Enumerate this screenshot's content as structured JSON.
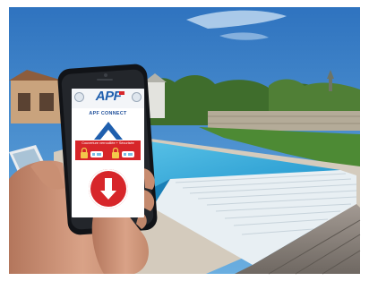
{
  "photo": {
    "subject": "hand-holding-smartphone-by-pool",
    "colors": {
      "sky": "#3d82c8",
      "pool_water": "#2ea7d8",
      "cover_slats": "#e8eff3",
      "deck": "#8d8580",
      "phone_body": "#111317",
      "skin": "#c99075",
      "lawn": "#4d8a34"
    }
  },
  "app": {
    "brand": "APF",
    "subtitle": "APF CONNECT",
    "status_text": "Couverture verrouillée + Sécurisée",
    "colors": {
      "brand_blue": "#1f5fae",
      "status_red": "#d7262a",
      "button_red": "#d7262a"
    },
    "icons": {
      "header_left": "settings-icon",
      "header_right": "info-icon",
      "open": "chevron-up-icon",
      "close": "arrow-down-icon",
      "lock": "padlock-icon"
    }
  }
}
